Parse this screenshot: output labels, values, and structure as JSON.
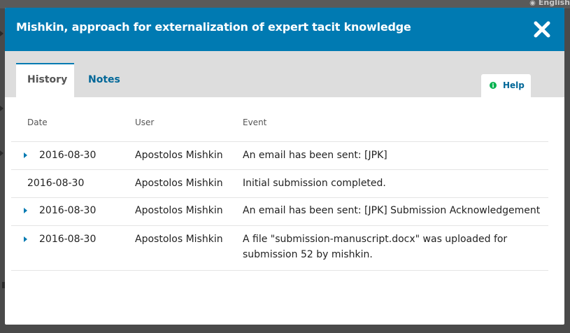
{
  "background": {
    "lang_label": "English"
  },
  "modal": {
    "title": "Mishkin, approach for externalization of expert tacit knowledge",
    "close_icon": "close-icon"
  },
  "tabs": [
    {
      "label": "History",
      "active": true
    },
    {
      "label": "Notes",
      "active": false
    }
  ],
  "help": {
    "label": "Help",
    "icon": "info-icon"
  },
  "table": {
    "columns": [
      "Date",
      "User",
      "Event"
    ],
    "rows": [
      {
        "date": "2016-08-30",
        "user": "Apostolos Mishkin",
        "event": "An email has been sent: [JPK]",
        "expandable": true
      },
      {
        "date": "2016-08-30",
        "user": "Apostolos Mishkin",
        "event": "Initial submission completed.",
        "expandable": false
      },
      {
        "date": "2016-08-30",
        "user": "Apostolos Mishkin",
        "event": "An email has been sent: [JPK] Submission Acknowledgement",
        "expandable": true
      },
      {
        "date": "2016-08-30",
        "user": "Apostolos Mishkin",
        "event": "A file \"submission-manuscript.docx\" was uploaded for submission 52 by mishkin.",
        "expandable": true
      }
    ]
  },
  "colors": {
    "header": "#007ab2",
    "tabbar": "#dddddd",
    "link": "#006798",
    "help_icon": "#00b24e"
  }
}
